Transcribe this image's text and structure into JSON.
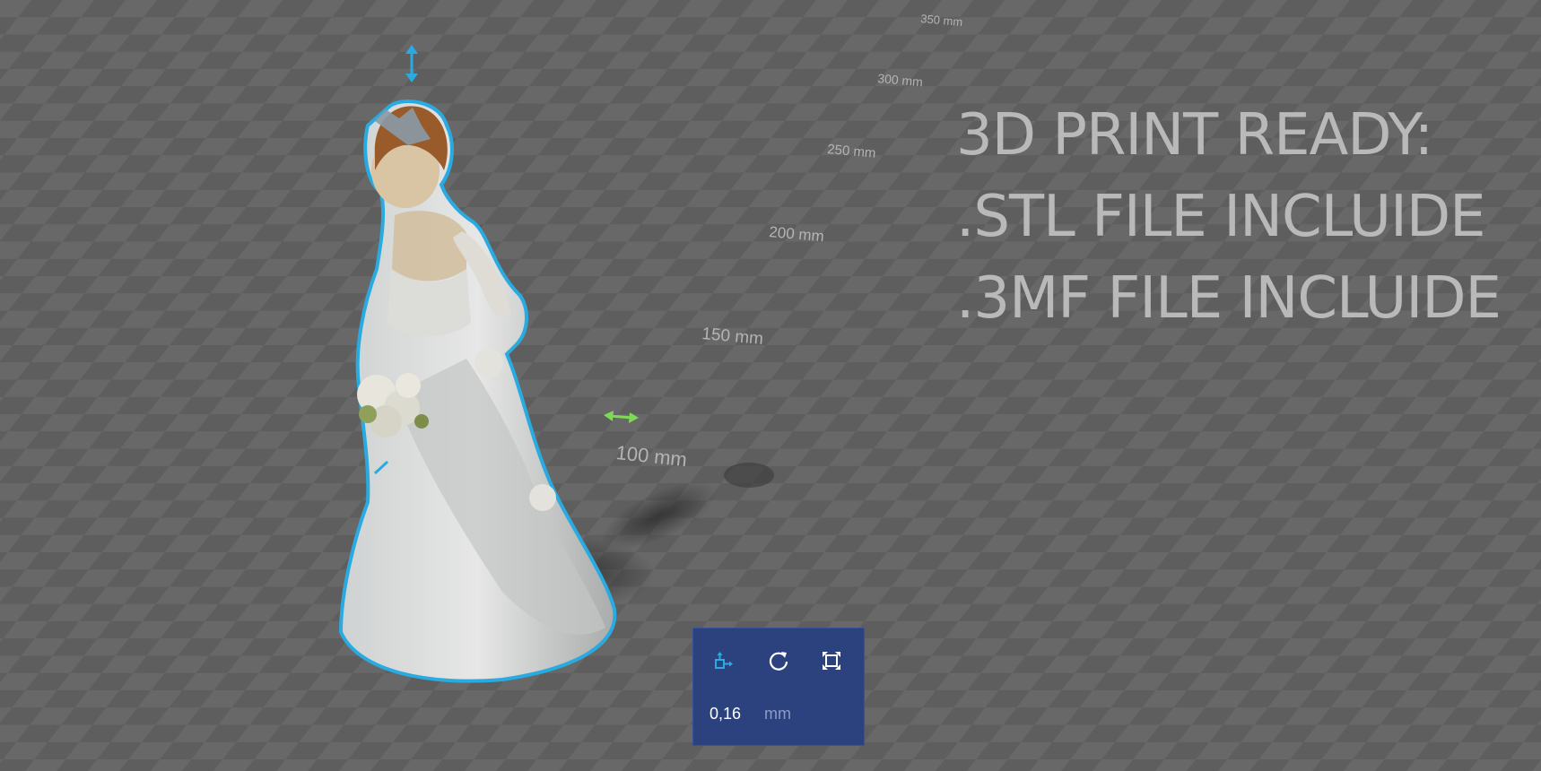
{
  "scene": {
    "grid_labels": [
      "350 mm",
      "300 mm",
      "250 mm",
      "200 mm",
      "150 mm",
      "100 mm"
    ],
    "selection_outline_color": "#29abe2",
    "move_gizmo_color": "#7ed957",
    "object": "bride-figurine"
  },
  "promo": {
    "line1": "3D PRINT READY:",
    "line2": ".STL FILE INCLUIDE",
    "line3": ".3MF FILE INCLUIDE"
  },
  "toolbox": {
    "tools": [
      {
        "name": "move-tool",
        "icon": "move-icon",
        "active": true
      },
      {
        "name": "rotate-tool",
        "icon": "rotate-icon",
        "active": false
      },
      {
        "name": "scale-tool",
        "icon": "scale-icon",
        "active": false
      }
    ],
    "value": "0,16",
    "unit": "mm",
    "accent": "#29abe2"
  }
}
